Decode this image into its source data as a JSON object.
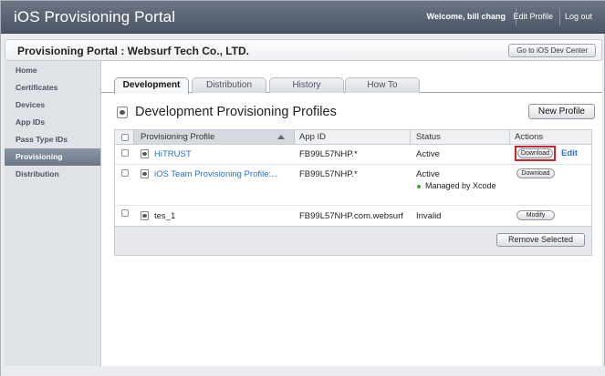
{
  "header": {
    "brand": "iOS Provisioning Portal",
    "welcome": "Welcome, bill chang",
    "edit_profile": "Edit Profile",
    "logout": "Log out"
  },
  "portal_bar": {
    "title": "Provisioning Portal : Websurf Tech Co., LTD.",
    "dev_center_button": "Go to iOS Dev Center"
  },
  "sidebar": {
    "items": [
      {
        "label": "Home"
      },
      {
        "label": "Certificates"
      },
      {
        "label": "Devices"
      },
      {
        "label": "App IDs"
      },
      {
        "label": "Pass Type IDs"
      },
      {
        "label": "Provisioning",
        "active": true
      },
      {
        "label": "Distribution"
      }
    ]
  },
  "tabs": [
    {
      "label": "Development",
      "active": true
    },
    {
      "label": "Distribution"
    },
    {
      "label": "History"
    },
    {
      "label": "How To"
    }
  ],
  "section": {
    "title": "Development Provisioning Profiles",
    "new_profile_button": "New Profile"
  },
  "table": {
    "columns": [
      "Provisioning Profile",
      "App ID",
      "Status",
      "Actions"
    ],
    "rows": [
      {
        "name": "HiTRUST",
        "app_id": "FB99L57NHP.*",
        "status": "Active",
        "action": "Download",
        "edit": "Edit",
        "highlight": true
      },
      {
        "name": "iOS Team Provisioning Profile:...",
        "app_id": "FB99L57NHP.*",
        "status": "Active",
        "note": "Managed by Xcode",
        "action": "Download"
      },
      {
        "name": "tes_1",
        "app_id": "FB99L57NHP.com.websurf",
        "status": "Invalid",
        "action": "Modify"
      }
    ],
    "remove_button": "Remove Selected"
  },
  "colors": {
    "header_bg": "#5a6371",
    "link": "#2a6fc4",
    "highlight": "#d3232a",
    "active_dot": "#39a535"
  }
}
